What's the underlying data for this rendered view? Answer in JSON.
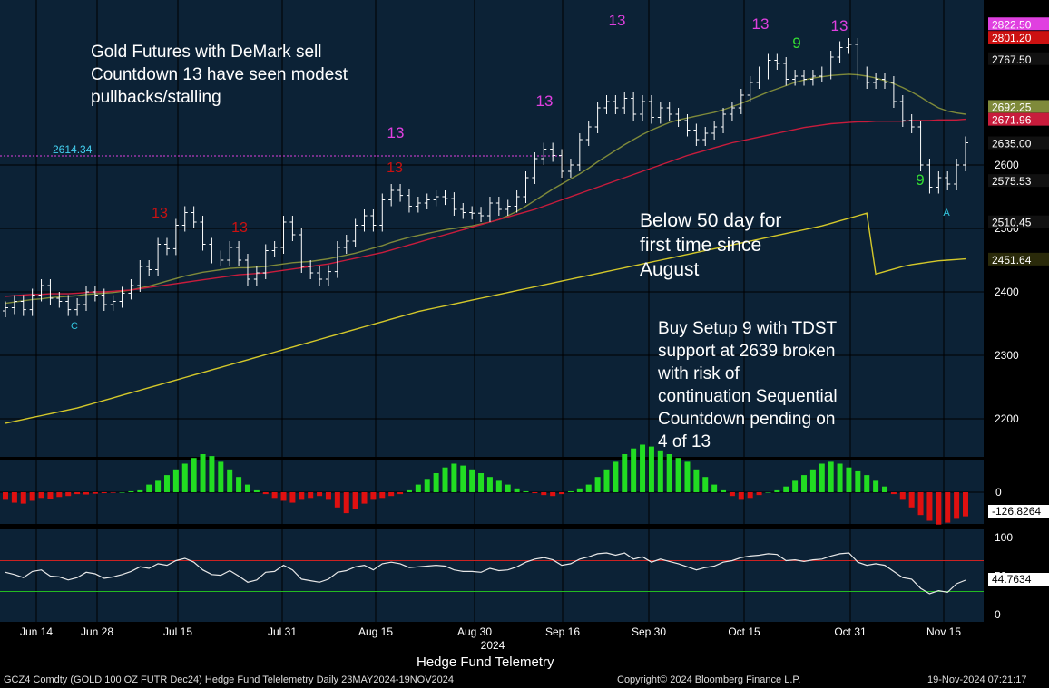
{
  "chart_data": {
    "type": "candlestick",
    "subtitle": "Hedge Fund Telemetry",
    "x_ticks": [
      "Jun 14",
      "Jun 28",
      "Jul 15",
      "Jul 31",
      "Aug 15",
      "Aug 30",
      "Sep 16",
      "Sep 30",
      "Oct 15",
      "Oct 31",
      "Nov 15"
    ],
    "year_label": "2024",
    "price_axis": {
      "ylim": [
        2140,
        2860
      ],
      "ticks": [
        2200,
        2300,
        2400,
        2500,
        2600
      ]
    },
    "right_labels": [
      {
        "text": "2822.50",
        "value": 2822.5,
        "color": "#e040e0"
      },
      {
        "text": "2801.20",
        "value": 2801.2,
        "color": "#cc1111"
      },
      {
        "text": "2767.50",
        "value": 2767.5,
        "color": "#111111"
      },
      {
        "text": "2692.25",
        "value": 2692.25,
        "color": "#7f8a3a"
      },
      {
        "text": "2671.96",
        "value": 2671.96,
        "color": "#c81c3c"
      },
      {
        "text": "2635.00",
        "value": 2635.0,
        "color": "#111111"
      },
      {
        "text": "2575.53",
        "value": 2575.53,
        "color": "#111111"
      },
      {
        "text": "2510.45",
        "value": 2510.45,
        "color": "#111111"
      },
      {
        "text": "2451.64",
        "value": 2451.64,
        "color": "#2a2a0a"
      }
    ],
    "level_label": {
      "text": "2614.34",
      "value": 2614.34
    },
    "series": [
      {
        "name": "close",
        "values": [
          2375,
          2385,
          2372,
          2395,
          2410,
          2390,
          2385,
          2372,
          2380,
          2400,
          2395,
          2380,
          2385,
          2398,
          2410,
          2440,
          2435,
          2475,
          2468,
          2505,
          2525,
          2510,
          2475,
          2455,
          2450,
          2470,
          2450,
          2420,
          2430,
          2465,
          2470,
          2510,
          2490,
          2440,
          2430,
          2420,
          2432,
          2470,
          2480,
          2505,
          2520,
          2505,
          2545,
          2560,
          2552,
          2535,
          2540,
          2545,
          2550,
          2547,
          2530,
          2525,
          2524,
          2520,
          2540,
          2530,
          2535,
          2550,
          2580,
          2610,
          2625,
          2615,
          2590,
          2600,
          2640,
          2660,
          2690,
          2700,
          2690,
          2705,
          2680,
          2700,
          2675,
          2690,
          2680,
          2670,
          2655,
          2640,
          2650,
          2660,
          2680,
          2690,
          2710,
          2730,
          2745,
          2765,
          2760,
          2735,
          2740,
          2735,
          2740,
          2745,
          2770,
          2785,
          2790,
          2745,
          2730,
          2735,
          2730,
          2700,
          2670,
          2660,
          2600,
          2565,
          2580,
          2570,
          2600,
          2635
        ]
      },
      {
        "name": "20 day ma",
        "values": [
          2382,
          2384,
          2386,
          2388,
          2389,
          2391,
          2392,
          2393,
          2394,
          2396,
          2397,
          2398,
          2399,
          2401,
          2403,
          2406,
          2409,
          2413,
          2417,
          2421,
          2425,
          2428,
          2431,
          2433,
          2435,
          2437,
          2438,
          2438,
          2439,
          2440,
          2442,
          2444,
          2446,
          2447,
          2448,
          2450,
          2452,
          2455,
          2458,
          2461,
          2465,
          2469,
          2473,
          2478,
          2482,
          2486,
          2489,
          2492,
          2495,
          2498,
          2500,
          2502,
          2504,
          2507,
          2510,
          2514,
          2520,
          2527,
          2535,
          2544,
          2553,
          2562,
          2570,
          2578,
          2586,
          2595,
          2605,
          2614,
          2623,
          2632,
          2640,
          2648,
          2655,
          2661,
          2667,
          2671,
          2674,
          2677,
          2680,
          2683,
          2687,
          2692,
          2697,
          2703,
          2709,
          2715,
          2720,
          2725,
          2730,
          2734,
          2737,
          2739,
          2741,
          2742,
          2743,
          2742,
          2740,
          2737,
          2733,
          2728,
          2722,
          2715,
          2707,
          2698,
          2690,
          2685,
          2682,
          2680
        ]
      },
      {
        "name": "50 day ma",
        "values": [
          2393,
          2394,
          2395,
          2396,
          2396,
          2397,
          2397,
          2397,
          2398,
          2399,
          2400,
          2400,
          2401,
          2402,
          2403,
          2405,
          2407,
          2409,
          2411,
          2413,
          2415,
          2417,
          2419,
          2421,
          2423,
          2425,
          2427,
          2428,
          2429,
          2430,
          2432,
          2434,
          2436,
          2438,
          2440,
          2442,
          2444,
          2447,
          2450,
          2453,
          2456,
          2459,
          2462,
          2466,
          2470,
          2474,
          2478,
          2482,
          2486,
          2490,
          2494,
          2498,
          2502,
          2506,
          2510,
          2514,
          2518,
          2522,
          2526,
          2530,
          2535,
          2540,
          2545,
          2550,
          2555,
          2560,
          2565,
          2570,
          2575,
          2580,
          2585,
          2590,
          2595,
          2600,
          2605,
          2610,
          2615,
          2619,
          2623,
          2627,
          2631,
          2635,
          2638,
          2641,
          2644,
          2647,
          2650,
          2653,
          2656,
          2659,
          2661,
          2663,
          2665,
          2666,
          2667,
          2668,
          2668,
          2669,
          2669,
          2669,
          2669,
          2670,
          2670,
          2670,
          2671,
          2671,
          2671,
          2672
        ]
      },
      {
        "name": "200 day ma",
        "values": [
          2193,
          2196,
          2199,
          2202,
          2205,
          2208,
          2211,
          2214,
          2217,
          2221,
          2225,
          2229,
          2233,
          2237,
          2241,
          2245,
          2249,
          2253,
          2257,
          2261,
          2265,
          2269,
          2273,
          2277,
          2281,
          2285,
          2289,
          2293,
          2297,
          2301,
          2305,
          2309,
          2313,
          2317,
          2321,
          2325,
          2329,
          2333,
          2337,
          2341,
          2345,
          2349,
          2353,
          2357,
          2361,
          2365,
          2369,
          2372,
          2375,
          2378,
          2381,
          2384,
          2387,
          2390,
          2393,
          2396,
          2399,
          2402,
          2405,
          2408,
          2411,
          2414,
          2417,
          2420,
          2423,
          2426,
          2429,
          2432,
          2435,
          2438,
          2441,
          2444,
          2447,
          2450,
          2453,
          2456,
          2459,
          2462,
          2465,
          2468,
          2471,
          2474,
          2477,
          2480,
          2483,
          2486,
          2489,
          2492,
          2495,
          2498,
          2501,
          2504,
          2508,
          2512,
          2516,
          2520,
          2524,
          2428,
          2432,
          2436,
          2440,
          2443,
          2445,
          2447,
          2449,
          2450,
          2451,
          2452
        ]
      }
    ],
    "oscillator": {
      "zero_label": "0",
      "last_label": "-126.8264",
      "values": [
        -40,
        -55,
        -60,
        -45,
        -30,
        -35,
        -25,
        -20,
        -10,
        -12,
        -8,
        -5,
        -3,
        0,
        5,
        10,
        40,
        60,
        90,
        120,
        150,
        180,
        200,
        190,
        160,
        120,
        80,
        40,
        10,
        -10,
        -30,
        -45,
        -55,
        -40,
        -30,
        -20,
        -40,
        -80,
        -110,
        -90,
        -60,
        -40,
        -30,
        -20,
        -10,
        10,
        40,
        70,
        100,
        130,
        150,
        140,
        120,
        100,
        80,
        60,
        40,
        20,
        5,
        -5,
        -15,
        -20,
        -10,
        5,
        20,
        40,
        80,
        120,
        160,
        200,
        230,
        250,
        240,
        220,
        200,
        180,
        160,
        120,
        80,
        40,
        10,
        -20,
        -40,
        -30,
        -15,
        0,
        10,
        30,
        60,
        90,
        120,
        150,
        160,
        150,
        130,
        110,
        90,
        60,
        30,
        -10,
        -40,
        -80,
        -120,
        -150,
        -170,
        -160,
        -140,
        -126.8
      ]
    },
    "rsi": {
      "ticks": [
        0,
        50,
        100
      ],
      "last_label": "44.7634",
      "overbought": 70,
      "oversold": 30,
      "values": [
        55,
        52,
        48,
        56,
        58,
        50,
        49,
        45,
        48,
        55,
        53,
        47,
        49,
        52,
        56,
        62,
        60,
        66,
        64,
        70,
        73,
        68,
        58,
        52,
        51,
        57,
        50,
        42,
        45,
        55,
        56,
        64,
        58,
        46,
        44,
        42,
        46,
        55,
        57,
        62,
        64,
        58,
        66,
        68,
        66,
        61,
        62,
        63,
        64,
        63,
        58,
        56,
        56,
        55,
        60,
        57,
        58,
        62,
        68,
        72,
        74,
        71,
        64,
        66,
        72,
        75,
        79,
        80,
        77,
        80,
        72,
        75,
        68,
        72,
        69,
        66,
        62,
        58,
        61,
        63,
        68,
        70,
        74,
        76,
        77,
        79,
        78,
        70,
        71,
        69,
        71,
        72,
        76,
        79,
        80,
        68,
        64,
        66,
        64,
        56,
        48,
        46,
        34,
        27,
        31,
        29,
        40,
        44.76
      ]
    }
  },
  "annotations": {
    "top_left": "Gold Futures with DeMark sell\nCountdown 13 have seen modest\npullbacks/stalling",
    "mid": "Below 50 day for\nfirst time since\nAugust",
    "bottom": "Buy Setup 9 with TDST\nsupport at 2639 broken\nwith risk of\ncontinuation Sequential\nCountdown pending on\n4 of 13"
  },
  "markers": [
    {
      "text": "13",
      "color": "#e040e0"
    },
    {
      "text": "13",
      "color": "#cc1111"
    },
    {
      "text": "9",
      "color": "#33dd33"
    },
    {
      "text": "C",
      "color": "#33c7e0"
    },
    {
      "text": "A",
      "color": "#33c7e0"
    }
  ],
  "footer": {
    "left": "GCZ4 Comdty (GOLD 100 OZ FUTR  Dec24) Hedge Fund Telelemetry  Daily 23MAY2024-19NOV2024",
    "center": "Copyright© 2024 Bloomberg Finance L.P.",
    "right": "19-Nov-2024 07:21:17"
  },
  "colors": {
    "panel_bg": "#0c2236",
    "ma20": "#7f8a3a",
    "ma50": "#c81c3c",
    "ma200": "#d4c82a",
    "osc_pos": "#22dd22",
    "osc_neg": "#e01010",
    "rsi_line": "#e8e8e8"
  }
}
